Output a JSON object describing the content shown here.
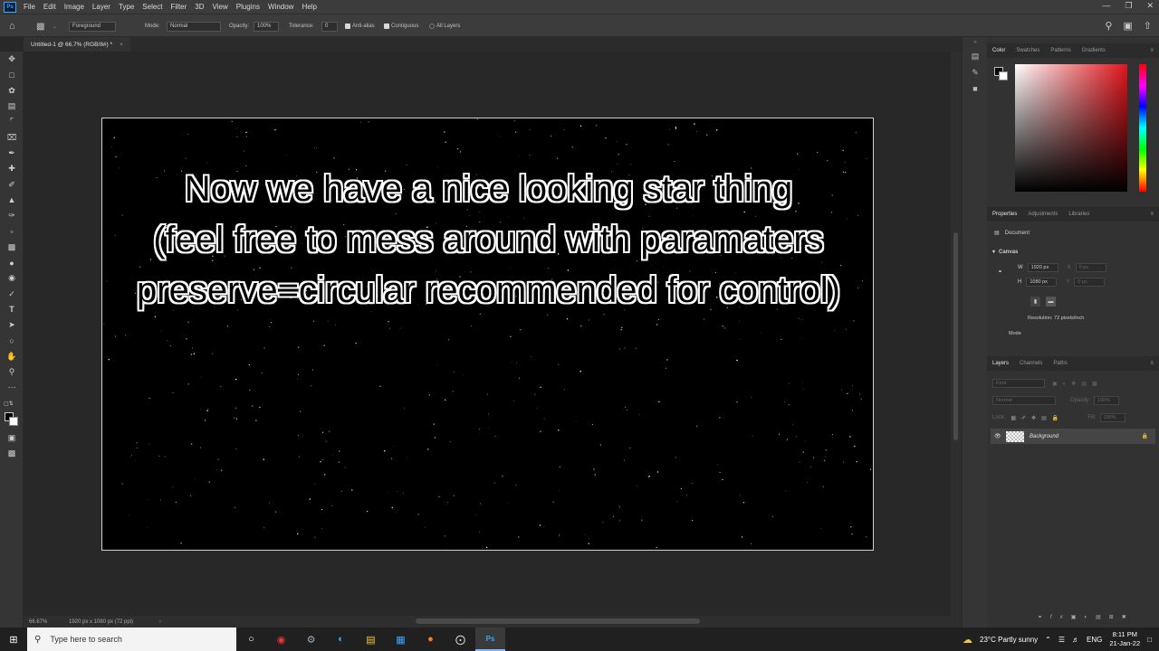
{
  "app": {
    "logo": "Ps",
    "menu": [
      "File",
      "Edit",
      "Image",
      "Layer",
      "Type",
      "Select",
      "Filter",
      "3D",
      "View",
      "Plugins",
      "Window",
      "Help"
    ]
  },
  "options_bar": {
    "sample_source": "Foreground",
    "mode_label": "Mode:",
    "mode_value": "Normal",
    "opacity_label": "Opacity:",
    "opacity_value": "100%",
    "tolerance_label": "Tolerance:",
    "tolerance_value": "0",
    "anti_alias": "Anti-alias",
    "contiguous": "Contiguous",
    "all_layers": "All Layers"
  },
  "document": {
    "tab_title": "Untitled-1 @ 66.7% (RGB/8#) *",
    "zoom": "66.67%",
    "info": "1920 px x 1080 px (72 ppi)"
  },
  "canvas_text": [
    "Now we have a nice looking star thing",
    "(feel free to mess around with paramaters",
    "preserve=circular recommended for control)"
  ],
  "color_panel": {
    "tabs": [
      "Color",
      "Swatches",
      "Patterns",
      "Gradients"
    ],
    "accent": "#e0141b"
  },
  "properties_panel": {
    "tabs": [
      "Properties",
      "Adjustments",
      "Libraries"
    ],
    "section_document": "Document",
    "section_canvas": "Canvas",
    "w_label": "W",
    "w_value": "1920 px",
    "h_label": "H",
    "h_value": "1080 px",
    "x_label": "X",
    "x_value": "0 px",
    "y_label": "Y",
    "y_value": "0 px",
    "resolution": "Resolution: 72 pixels/inch",
    "mode_label": "Mode"
  },
  "layers_panel": {
    "tabs": [
      "Layers",
      "Channels",
      "Paths"
    ],
    "search_placeholder": "Kind",
    "blend_mode": "Normal",
    "opacity_label": "Opacity:",
    "opacity_value": "100%",
    "lock_label": "Lock:",
    "fill_label": "Fill:",
    "fill_value": "100%",
    "layer_name": "Background"
  },
  "taskbar": {
    "search_placeholder": "Type here to search",
    "weather": "23°C  Partly sunny",
    "language": "ENG",
    "time": "8:11 PM",
    "date": "21-Jan-22"
  }
}
